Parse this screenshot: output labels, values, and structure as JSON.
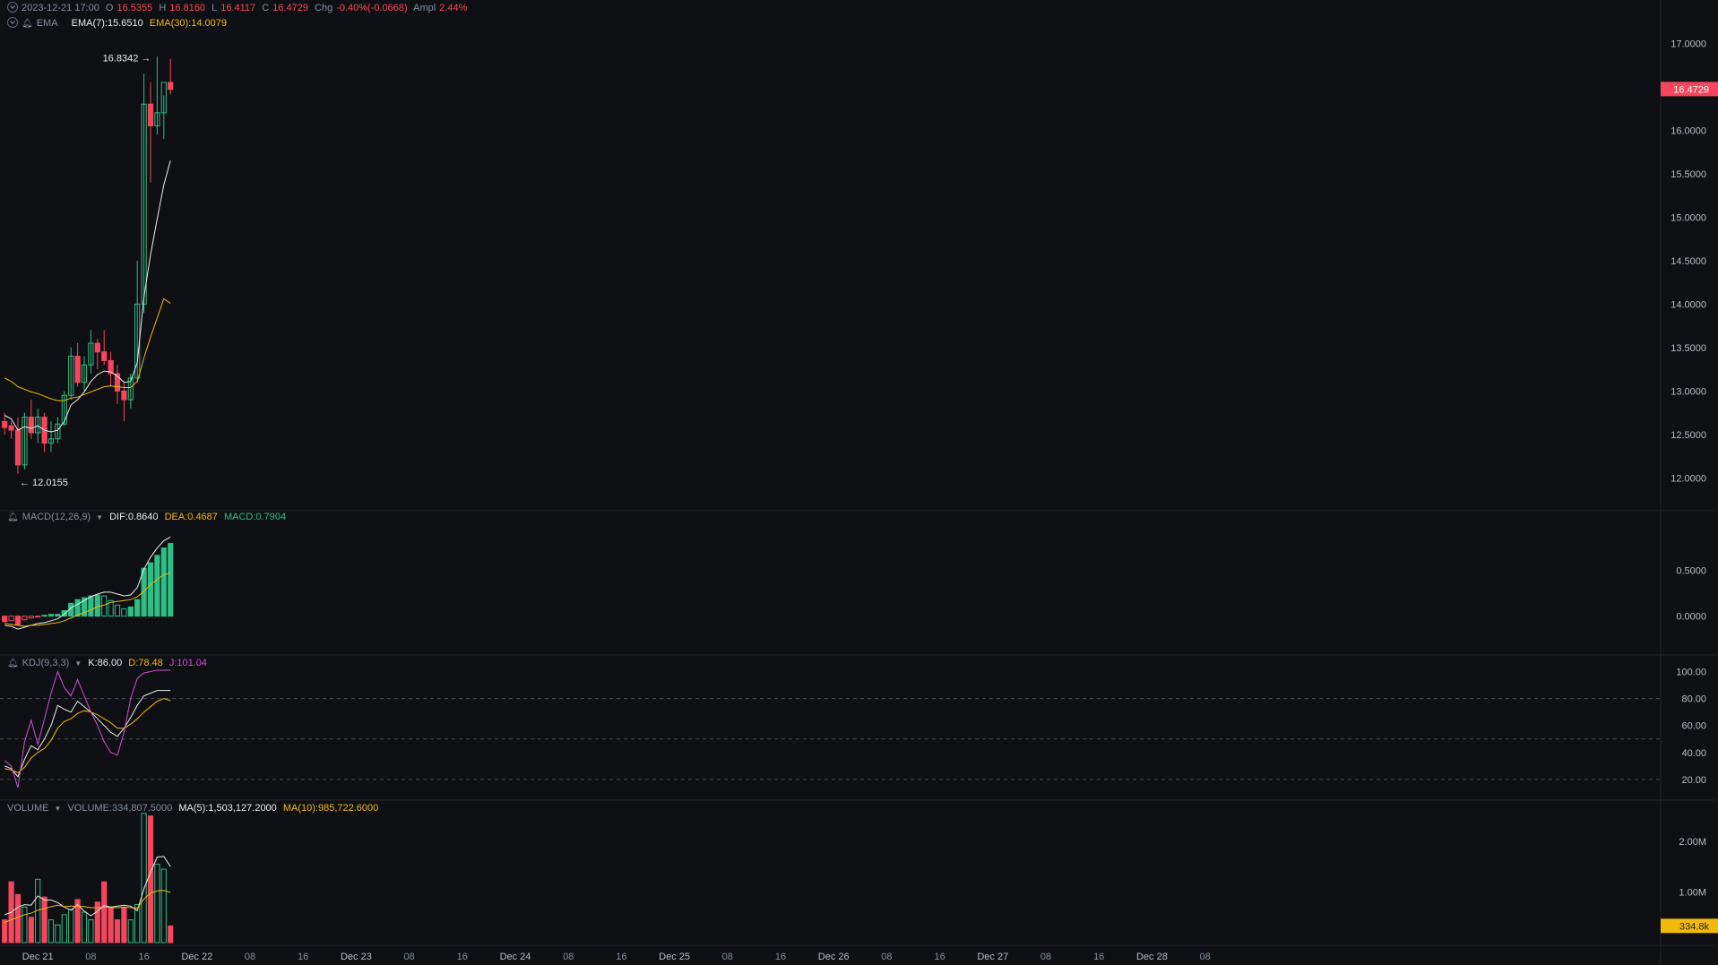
{
  "ohlc_bar": {
    "time": "2023-12-21 17:00",
    "o_label": "O",
    "o": "16.5355",
    "h_label": "H",
    "h": "16.8160",
    "l_label": "L",
    "l": "16.4117",
    "c_label": "C",
    "c": "16.4729",
    "chg_label": "Chg",
    "chg": "-0.40%(-0.0668)",
    "ampl_label": "Ampl",
    "ampl": "2.44%"
  },
  "ema_bar": {
    "name": "EMA",
    "ema7": "EMA(7):15.6510",
    "ema30": "EMA(30):14.0079"
  },
  "macd_bar": {
    "name": "MACD(12,26,9)",
    "dif": "DIF:0.8640",
    "dea": "DEA:0.4687",
    "macd": "MACD:0.7904"
  },
  "kdj_bar": {
    "name": "KDJ(9,3,3)",
    "k": "K:86.00",
    "d": "D:78.48",
    "j": "J:101.04"
  },
  "volume_bar": {
    "name": "VOLUME",
    "vol": "VOLUME:334,807.5000",
    "ma5": "MA(5):1,503,127.2000",
    "ma10": "MA(10):985,722.6000"
  },
  "colors": {
    "background": "#0f1014",
    "up": "#2ebd85",
    "down": "#f6465d",
    "ema7": "#eaecef",
    "ema30": "#f0b90b",
    "kdj_j": "#d24fd3",
    "price_tag": "#f6465d",
    "volume_tag": "#f0b90b"
  },
  "chart_data": [
    {
      "type": "candlestick",
      "name": "price",
      "ylim": [
        11.85,
        17.25
      ],
      "yticks": [
        "17.0000",
        "16.5000",
        "16.0000",
        "15.5000",
        "15.0000",
        "14.5000",
        "14.0000",
        "13.5000",
        "13.0000",
        "12.5000",
        "12.0000"
      ],
      "current_price": "16.4729",
      "max_label": "16.8342",
      "min_label": "12.0155",
      "candles": [
        [
          12.65,
          12.75,
          12.5,
          12.58
        ],
        [
          12.6,
          12.65,
          12.45,
          12.55
        ],
        [
          12.55,
          12.7,
          12.05,
          12.15
        ],
        [
          12.15,
          12.75,
          12.1,
          12.7
        ],
        [
          12.7,
          12.9,
          12.45,
          12.52
        ],
        [
          12.52,
          12.8,
          12.4,
          12.7
        ],
        [
          12.7,
          12.75,
          12.3,
          12.4
        ],
        [
          12.4,
          12.65,
          12.3,
          12.45
        ],
        [
          12.45,
          12.7,
          12.4,
          12.62
        ],
        [
          12.62,
          13.0,
          12.6,
          12.95
        ],
        [
          12.95,
          13.5,
          12.9,
          13.4
        ],
        [
          13.4,
          13.55,
          13.05,
          13.1
        ],
        [
          13.1,
          13.4,
          13.0,
          13.3
        ],
        [
          13.3,
          13.7,
          13.2,
          13.55
        ],
        [
          13.55,
          13.6,
          13.25,
          13.45
        ],
        [
          13.45,
          13.7,
          13.3,
          13.35
        ],
        [
          13.35,
          13.45,
          13.05,
          13.2
        ],
        [
          13.2,
          13.3,
          12.85,
          13.0
        ],
        [
          13.0,
          13.1,
          12.65,
          12.9
        ],
        [
          12.9,
          13.2,
          12.8,
          13.15
        ],
        [
          13.15,
          14.5,
          13.1,
          14.0
        ],
        [
          14.0,
          16.65,
          13.9,
          16.3
        ],
        [
          16.3,
          16.55,
          15.4,
          16.05
        ],
        [
          16.05,
          16.85,
          15.95,
          16.2
        ],
        [
          16.2,
          16.4,
          15.9,
          16.55
        ],
        [
          16.55,
          16.82,
          16.41,
          16.47
        ]
      ],
      "series": [
        {
          "name": "EMA(7)",
          "values": [
            12.72,
            12.68,
            12.55,
            12.59,
            12.57,
            12.6,
            12.55,
            12.53,
            12.55,
            12.65,
            12.84,
            12.9,
            12.99,
            13.11,
            13.19,
            13.23,
            13.22,
            13.17,
            13.1,
            13.11,
            13.33,
            14.08,
            14.57,
            14.98,
            15.37,
            15.65
          ]
        },
        {
          "name": "EMA(30)",
          "values": [
            13.15,
            13.11,
            13.05,
            13.02,
            12.99,
            12.97,
            12.94,
            12.91,
            12.89,
            12.89,
            12.92,
            12.93,
            12.96,
            12.99,
            13.02,
            13.05,
            13.06,
            13.05,
            13.04,
            13.04,
            13.11,
            13.38,
            13.62,
            13.84,
            14.06,
            14.01
          ]
        }
      ]
    },
    {
      "type": "bar",
      "name": "MACD(12,26,9)",
      "ylim": [
        -0.12,
        0.95
      ],
      "yticks": [
        "0.5000",
        "0.0000"
      ],
      "values": [
        -0.06,
        -0.05,
        -0.09,
        -0.04,
        -0.02,
        -0.01,
        0.01,
        0.02,
        0.02,
        0.06,
        0.14,
        0.18,
        0.2,
        0.22,
        0.23,
        0.22,
        0.17,
        0.12,
        0.08,
        0.1,
        0.18,
        0.52,
        0.58,
        0.66,
        0.74,
        0.79
      ],
      "series": [
        {
          "name": "DIF",
          "values": [
            -0.1,
            -0.11,
            -0.14,
            -0.12,
            -0.1,
            -0.08,
            -0.07,
            -0.05,
            -0.03,
            0.02,
            0.09,
            0.13,
            0.17,
            0.21,
            0.24,
            0.26,
            0.26,
            0.24,
            0.22,
            0.23,
            0.31,
            0.51,
            0.64,
            0.74,
            0.82,
            0.86
          ]
        },
        {
          "name": "DEA",
          "values": [
            -0.08,
            -0.09,
            -0.1,
            -0.11,
            -0.1,
            -0.1,
            -0.09,
            -0.08,
            -0.07,
            -0.05,
            -0.02,
            0.01,
            0.04,
            0.07,
            0.1,
            0.12,
            0.15,
            0.16,
            0.17,
            0.18,
            0.21,
            0.27,
            0.34,
            0.4,
            0.45,
            0.47
          ]
        }
      ]
    },
    {
      "type": "line",
      "name": "KDJ(9,3,3)",
      "ylim": [
        10,
        105
      ],
      "yticks": [
        "100.00",
        "80.00",
        "60.00",
        "40.00",
        "20.00"
      ],
      "dashed_levels": [
        80,
        50,
        20
      ],
      "series": [
        {
          "name": "K",
          "values": [
            30,
            28,
            22,
            35,
            45,
            42,
            50,
            60,
            75,
            72,
            70,
            78,
            74,
            70,
            65,
            60,
            55,
            52,
            58,
            66,
            75,
            82,
            84,
            86,
            86,
            86
          ]
        },
        {
          "name": "D",
          "values": [
            28,
            27,
            25,
            29,
            36,
            40,
            43,
            49,
            58,
            63,
            65,
            69,
            71,
            70,
            68,
            65,
            62,
            58,
            58,
            61,
            65,
            70,
            74,
            78,
            80,
            78.5
          ]
        },
        {
          "name": "J",
          "values": [
            34,
            30,
            14,
            48,
            64,
            46,
            65,
            84,
            100,
            88,
            82,
            94,
            82,
            70,
            60,
            48,
            40,
            38,
            55,
            80,
            95,
            99,
            100,
            101,
            101,
            101
          ]
        }
      ]
    },
    {
      "type": "bar",
      "name": "VOLUME",
      "ylim": [
        0,
        2.6
      ],
      "yticks": [
        "2.00M",
        "1.00M"
      ],
      "current_volume": "334.8k",
      "values": [
        0.45,
        1.2,
        0.95,
        0.7,
        0.5,
        1.25,
        0.9,
        0.45,
        0.35,
        0.55,
        0.65,
        0.85,
        0.6,
        0.45,
        0.8,
        1.2,
        0.7,
        0.45,
        0.7,
        0.45,
        0.75,
        2.55,
        2.5,
        1.55,
        1.45,
        0.33
      ],
      "series": [
        {
          "name": "MA(5)",
          "values": [
            0.55,
            0.6,
            0.7,
            0.75,
            0.74,
            0.92,
            0.84,
            0.84,
            0.79,
            0.7,
            0.64,
            0.75,
            0.62,
            0.53,
            0.62,
            0.73,
            0.7,
            0.72,
            0.74,
            0.72,
            0.63,
            1.06,
            1.39,
            1.69,
            1.7,
            1.5
          ]
        },
        {
          "name": "MA(10)",
          "values": [
            0.4,
            0.45,
            0.5,
            0.55,
            0.58,
            0.64,
            0.67,
            0.71,
            0.74,
            0.71,
            0.72,
            0.72,
            0.71,
            0.69,
            0.69,
            0.7,
            0.69,
            0.69,
            0.7,
            0.69,
            0.68,
            0.86,
            0.98,
            1.02,
            1.03,
            0.99
          ]
        }
      ]
    }
  ],
  "x_axis": {
    "ticks": [
      {
        "label": "Dec 21",
        "slot": 5
      },
      {
        "label": "08",
        "slot": 13
      },
      {
        "label": "16",
        "slot": 21
      },
      {
        "label": "Dec 22",
        "slot": 29
      },
      {
        "label": "08",
        "slot": 37
      },
      {
        "label": "16",
        "slot": 45
      },
      {
        "label": "Dec 23",
        "slot": 53
      },
      {
        "label": "08",
        "slot": 61
      },
      {
        "label": "16",
        "slot": 69
      },
      {
        "label": "Dec 24",
        "slot": 77
      },
      {
        "label": "08",
        "slot": 85
      },
      {
        "label": "16",
        "slot": 93
      },
      {
        "label": "Dec 25",
        "slot": 101
      },
      {
        "label": "08",
        "slot": 109
      },
      {
        "label": "16",
        "slot": 117
      },
      {
        "label": "Dec 26",
        "slot": 125
      },
      {
        "label": "08",
        "slot": 133
      },
      {
        "label": "16",
        "slot": 141
      },
      {
        "label": "Dec 27",
        "slot": 149
      },
      {
        "label": "08",
        "slot": 157
      },
      {
        "label": "16",
        "slot": 165
      },
      {
        "label": "Dec 28",
        "slot": 173
      },
      {
        "label": "08",
        "slot": 181
      }
    ]
  }
}
